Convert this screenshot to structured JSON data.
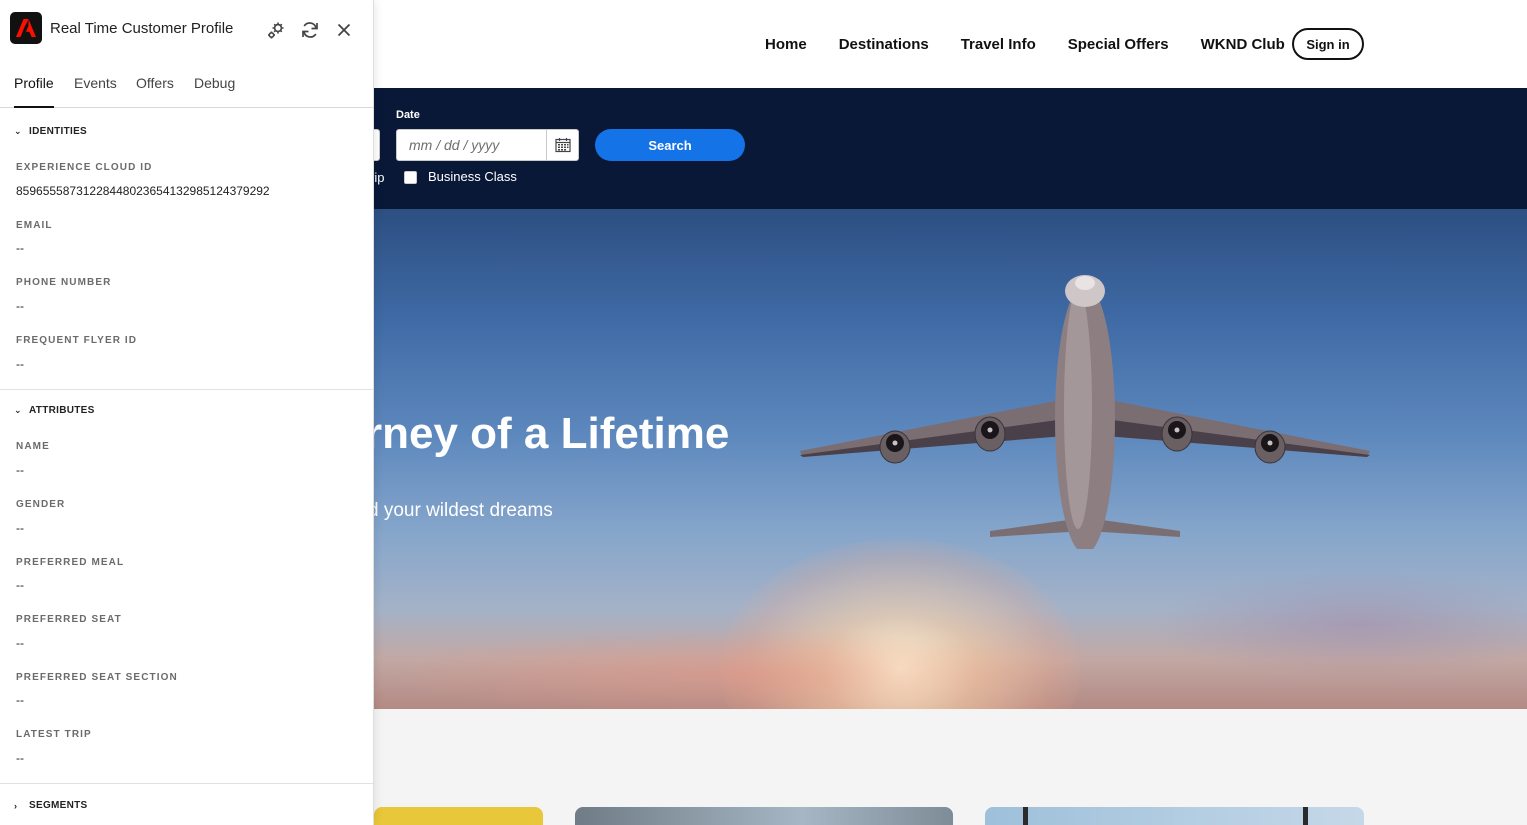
{
  "site": {
    "nav": [
      "Home",
      "Destinations",
      "Travel Info",
      "Special Offers",
      "WKND Club"
    ],
    "signin": "Sign in",
    "booking": {
      "date_label": "Date",
      "date_placeholder": "mm / dd / yyyy",
      "search_label": "Search",
      "trip_fragment": "rip",
      "business_class_label": "Business Class"
    },
    "hero": {
      "title": "rney of a Lifetime",
      "subtitle": "d your wildest dreams"
    },
    "colors": {
      "navy": "#0a1838",
      "accent": "#1473e6"
    }
  },
  "panel": {
    "title": "Real Time Customer Profile",
    "tabs": [
      "Profile",
      "Events",
      "Offers",
      "Debug"
    ],
    "identities": {
      "header": "IDENTITIES",
      "fields": [
        {
          "label": "EXPERIENCE CLOUD ID",
          "value": "85965558731228448023654132985124379292"
        },
        {
          "label": "EMAIL",
          "value": "--"
        },
        {
          "label": "PHONE NUMBER",
          "value": "--"
        },
        {
          "label": "FREQUENT FLYER ID",
          "value": "--"
        }
      ]
    },
    "attributes": {
      "header": "ATTRIBUTES",
      "fields": [
        {
          "label": "NAME",
          "value": "--"
        },
        {
          "label": "GENDER",
          "value": "--"
        },
        {
          "label": "PREFERRED MEAL",
          "value": "--"
        },
        {
          "label": "PREFERRED SEAT",
          "value": "--"
        },
        {
          "label": "PREFERRED SEAT SECTION",
          "value": "--"
        },
        {
          "label": "LATEST TRIP",
          "value": "--"
        }
      ]
    },
    "segments": {
      "header": "SEGMENTS"
    },
    "icons": [
      "adobe-logo-icon",
      "settings-icon",
      "refresh-icon",
      "close-icon",
      "chevron-down-icon",
      "chevron-right-icon",
      "calendar-icon"
    ]
  }
}
